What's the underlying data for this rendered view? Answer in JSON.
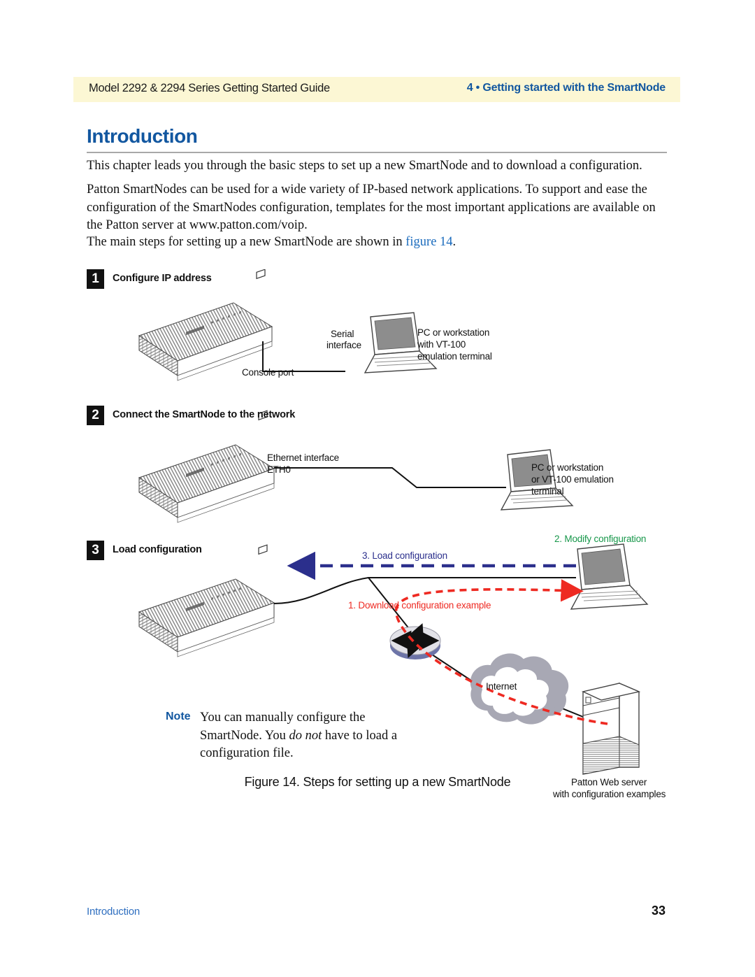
{
  "header": {
    "left": "Model 2292 & 2294 Series Getting Started Guide",
    "right": "4 • Getting started with the SmartNode",
    "band_color": "#fcf7d4",
    "accent_blue": "#1257a0"
  },
  "section": {
    "title": "Introduction"
  },
  "paragraphs": {
    "p1": "This chapter leads you through the basic steps to set up a new SmartNode and to download a configuration.",
    "p2": "Patton SmartNodes can be used for a wide variety of IP-based network applications. To support and ease the configuration of the SmartNodes configuration, templates for the most important applications are available on the Patton server at www.patton.com/voip.",
    "p3_before": "The main steps for setting up a new SmartNode are shown in ",
    "p3_xref": "figure 14",
    "p3_after": "."
  },
  "figure": {
    "caption": "Figure 14. Steps for setting up a new SmartNode",
    "steps": [
      {
        "number": "1",
        "label": "Configure IP address"
      },
      {
        "number": "2",
        "label": "Connect the SmartNode to the network"
      },
      {
        "number": "3",
        "label": "Load configuration"
      }
    ],
    "labels": {
      "console_port": "Console port",
      "serial_interface_l1": "Serial",
      "serial_interface_l2": "interface",
      "pc_vt100_l1": "PC or workstation",
      "pc_vt100_l2": "with VT-100",
      "pc_vt100_l3": "emulation terminal",
      "ethernet_l1": "Ethernet interface",
      "ethernet_l2": "ETH0",
      "pc_net_l1": "PC or workstation",
      "pc_net_l2": "or VT-100 emulation",
      "pc_net_l3": "terminal",
      "internet": "Internet",
      "web_server_l1": "Patton Web server",
      "web_server_l2": "with configuration examples",
      "flow_load": "3. Load configuration",
      "flow_modify": "2. Modify configuration",
      "flow_download": "1. Download configuration example"
    },
    "colors": {
      "load_arrow": "#2b2f8c",
      "modify_text": "#17974a",
      "download_arrow": "#ee2a22",
      "cloud": "#a8a8b4",
      "screen": "#8d8d8d"
    }
  },
  "note": {
    "label": "Note",
    "text_before": "You can manually configure the SmartNode. You ",
    "text_italic": "do not",
    "text_after": " have to load a configuration file."
  },
  "footer": {
    "left": "Introduction",
    "page": "33"
  }
}
